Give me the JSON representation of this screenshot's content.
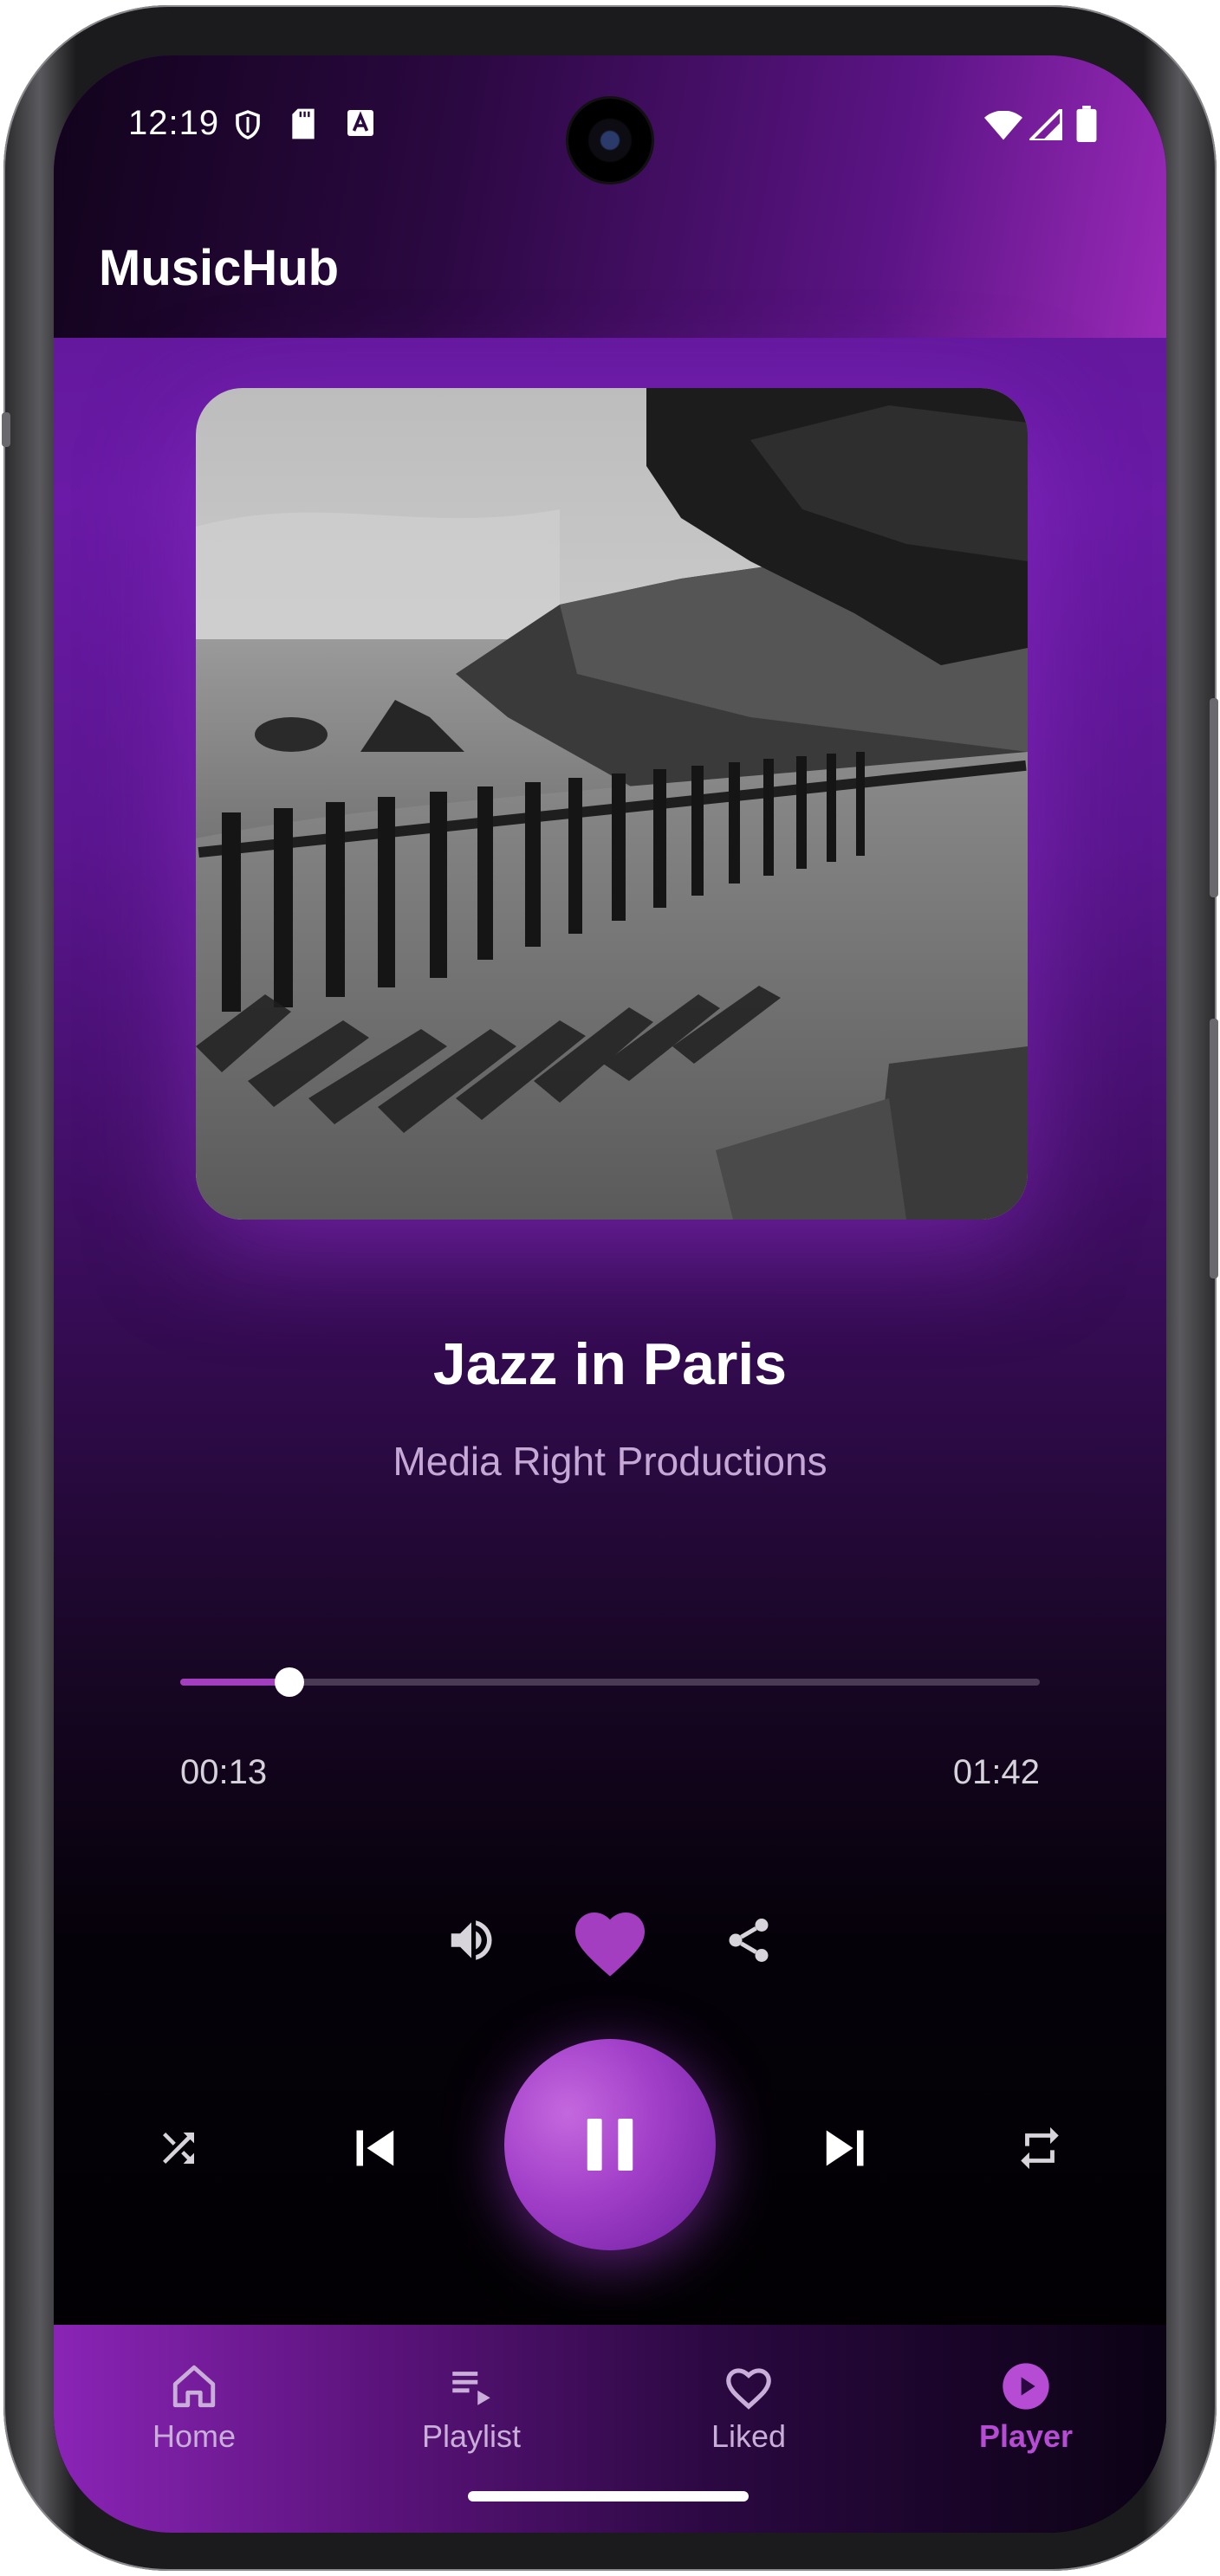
{
  "status_bar": {
    "time": "12:19"
  },
  "app": {
    "title": "MusicHub"
  },
  "track": {
    "title": "Jazz in Paris",
    "artist": "Media Right Productions",
    "current_time": "00:13",
    "total_time": "01:42",
    "progress_fraction": 0.127,
    "liked": true
  },
  "controls": {
    "volume_icon": "volume-up-icon",
    "like_icon": "heart-filled-icon",
    "share_icon": "share-icon",
    "shuffle_icon": "shuffle-icon",
    "previous_icon": "skip-previous-icon",
    "play_pause_icon": "pause-icon",
    "next_icon": "skip-next-icon",
    "repeat_icon": "repeat-icon"
  },
  "nav": {
    "items": [
      {
        "label": "Home",
        "icon": "home-icon",
        "active": false
      },
      {
        "label": "Playlist",
        "icon": "playlist-icon",
        "active": false
      },
      {
        "label": "Liked",
        "icon": "heart-outline-icon",
        "active": false
      },
      {
        "label": "Player",
        "icon": "play-circle-icon",
        "active": true
      }
    ]
  },
  "colors": {
    "accent": "#a43ec0",
    "active_nav": "#b64cd4",
    "inactive_nav": "#c8aed8",
    "artist_text": "#c6a8d6"
  }
}
